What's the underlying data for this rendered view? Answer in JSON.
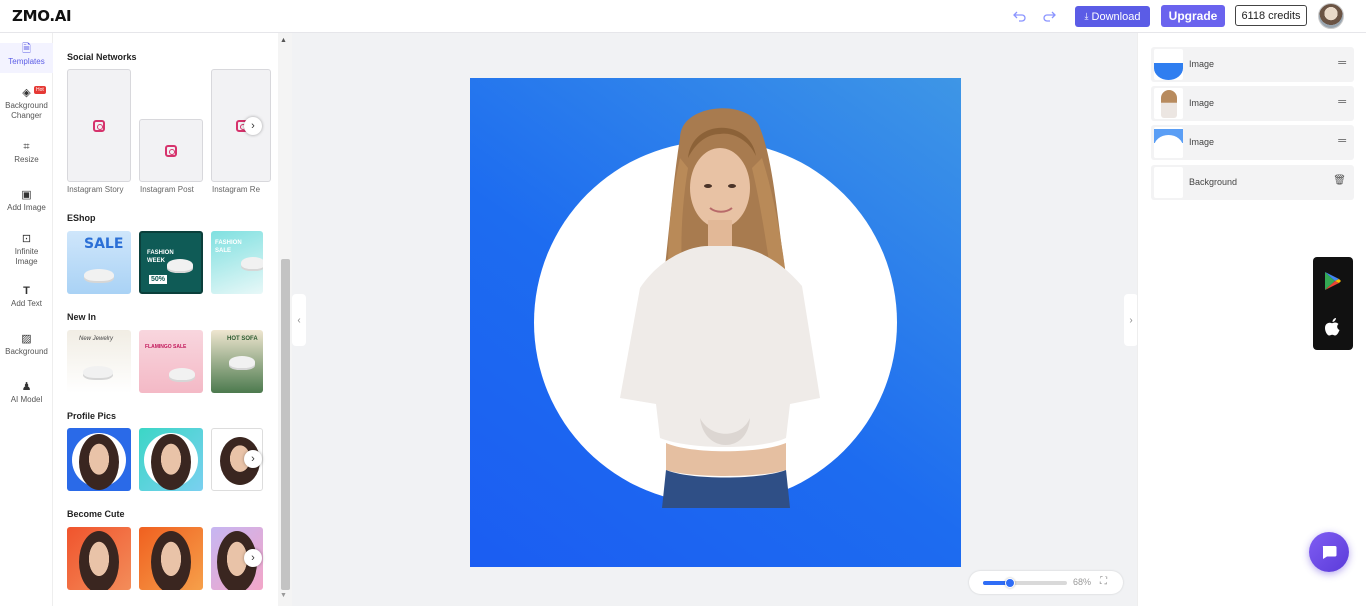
{
  "header": {
    "logo": "ZMO.AI",
    "download_label": "Download",
    "upgrade_label": "Upgrade",
    "credits_label": "6118 credits"
  },
  "rail": {
    "items": [
      {
        "label": "Templates",
        "icon": "template-icon"
      },
      {
        "label": "Background Changer",
        "icon": "layers-icon",
        "badge": "Hot"
      },
      {
        "label": "Resize",
        "icon": "crop-icon"
      },
      {
        "label": "Add Image",
        "icon": "image-icon"
      },
      {
        "label": "Infinite Image",
        "icon": "expand-image-icon"
      },
      {
        "label": "Add Text",
        "icon": "text-icon"
      },
      {
        "label": "Background",
        "icon": "background-icon"
      },
      {
        "label": "AI Model",
        "icon": "person-icon"
      }
    ]
  },
  "panel": {
    "sections": [
      {
        "title": "Social Networks",
        "captions": [
          "Instagram Story",
          "Instagram Post",
          "Instagram Re"
        ]
      },
      {
        "title": "EShop"
      },
      {
        "title": "New In"
      },
      {
        "title": "Profile Pics"
      },
      {
        "title": "Become Cute"
      }
    ],
    "eshop_texts": {
      "sale": "SALE",
      "fashion_week": "FASHION WEEK",
      "fashion_sale": "FASHION SALE",
      "discount": "50%"
    },
    "new_in_texts": {
      "new_jewelry": "New Jewelry",
      "flamingo": "FLAMINGO SALE",
      "hot_sofa": "HOT SOFA"
    }
  },
  "canvas": {
    "zoom": {
      "value_label": "68%",
      "level": 0.32
    }
  },
  "layers": {
    "items": [
      {
        "label": "Image",
        "kind": "shape"
      },
      {
        "label": "Image",
        "kind": "photo"
      },
      {
        "label": "Image",
        "kind": "shape"
      },
      {
        "label": "Background",
        "kind": "background"
      }
    ]
  },
  "colors": {
    "accent": "#5b5ce6",
    "canvas_top": "#3e96e6",
    "canvas_bottom": "#1b5df2",
    "chat": "#6a4ae8"
  }
}
